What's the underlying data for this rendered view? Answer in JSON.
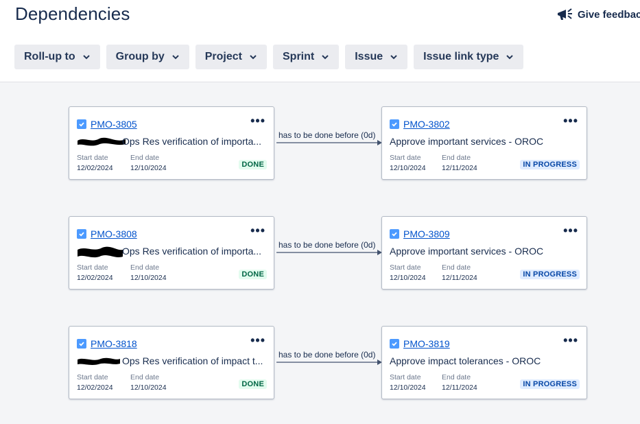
{
  "page": {
    "title": "Dependencies"
  },
  "feedback": {
    "label": "Give feedbac"
  },
  "filters": [
    {
      "label": "Roll-up to"
    },
    {
      "label": "Group by"
    },
    {
      "label": "Project"
    },
    {
      "label": "Sprint"
    },
    {
      "label": "Issue"
    },
    {
      "label": "Issue link type"
    }
  ],
  "dependencies": [
    {
      "source": {
        "key": "PMO-3805",
        "summary": "Ops Res verification of importa...",
        "start_label": "Start date",
        "start": "12/02/2024",
        "end_label": "End date",
        "end": "12/10/2024",
        "status": "DONE"
      },
      "link": "has to be done before (0d)",
      "target": {
        "key": "PMO-3802",
        "summary": "Approve important services - OROC",
        "start_label": "Start date",
        "start": "12/10/2024",
        "end_label": "End date",
        "end": "12/11/2024",
        "status": "IN PROGRESS"
      }
    },
    {
      "source": {
        "key": "PMO-3808",
        "summary": "Ops Res verification of importa...",
        "start_label": "Start date",
        "start": "12/02/2024",
        "end_label": "End date",
        "end": "12/10/2024",
        "status": "DONE"
      },
      "link": "has to be done before (0d)",
      "target": {
        "key": "PMO-3809",
        "summary": "Approve important services - OROC",
        "start_label": "Start date",
        "start": "12/10/2024",
        "end_label": "End date",
        "end": "12/11/2024",
        "status": "IN PROGRESS"
      }
    },
    {
      "source": {
        "key": "PMO-3818",
        "summary": "Ops Res verification of impact t...",
        "start_label": "Start date",
        "start": "12/02/2024",
        "end_label": "End date",
        "end": "12/10/2024",
        "status": "DONE"
      },
      "link": "has to be done before (0d)",
      "target": {
        "key": "PMO-3819",
        "summary": "Approve impact tolerances - OROC",
        "start_label": "Start date",
        "start": "12/10/2024",
        "end_label": "End date",
        "end": "12/11/2024",
        "status": "IN PROGRESS"
      }
    }
  ]
}
